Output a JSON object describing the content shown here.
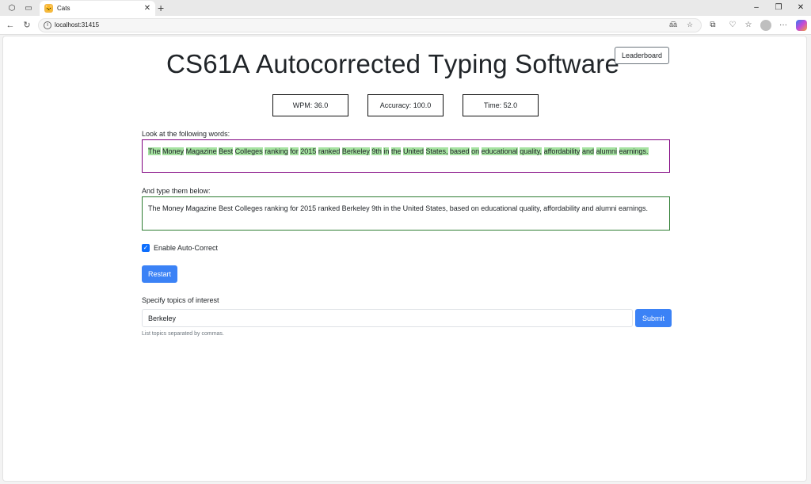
{
  "browser": {
    "tab_title": "Cats",
    "url": "localhost:31415"
  },
  "header": {
    "title_parts": [
      {
        "cap": "C",
        "rest": "S61A "
      },
      {
        "cap": "A",
        "rest": "utocorrected "
      },
      {
        "cap": "T",
        "rest": "yping "
      },
      {
        "cap": "S",
        "rest": "oftware"
      }
    ],
    "leaderboard_label": "Leaderboard"
  },
  "stats": {
    "wpm": "WPM: 36.0",
    "accuracy": "Accuracy: 100.0",
    "time": "Time: 52.0"
  },
  "prompt": {
    "label": "Look at the following words:",
    "words": [
      "The",
      "Money",
      "Magazine",
      "Best",
      "Colleges",
      "ranking",
      "for",
      "2015",
      "ranked",
      "Berkeley",
      "9th",
      "in",
      "the",
      "United",
      "States,",
      "based",
      "on",
      "educational",
      "quality,",
      "affordability",
      "and",
      "alumni",
      "earnings."
    ]
  },
  "typed": {
    "label": "And type them below:",
    "text": "The Money Magazine Best Colleges ranking for 2015 ranked Berkeley 9th in the United States, based on educational quality, affordability and alumni earnings."
  },
  "autocorrect": {
    "label": "Enable Auto-Correct",
    "checked": true
  },
  "restart_label": "Restart",
  "topics": {
    "label": "Specify topics of interest",
    "value": "Berkeley",
    "submit_label": "Submit",
    "help": "List topics separated by commas."
  },
  "colors": {
    "highlight": "#a6e3a1",
    "prompt_border": "#800080",
    "typed_border": "#2e7d32",
    "primary": "#3b82f6"
  }
}
